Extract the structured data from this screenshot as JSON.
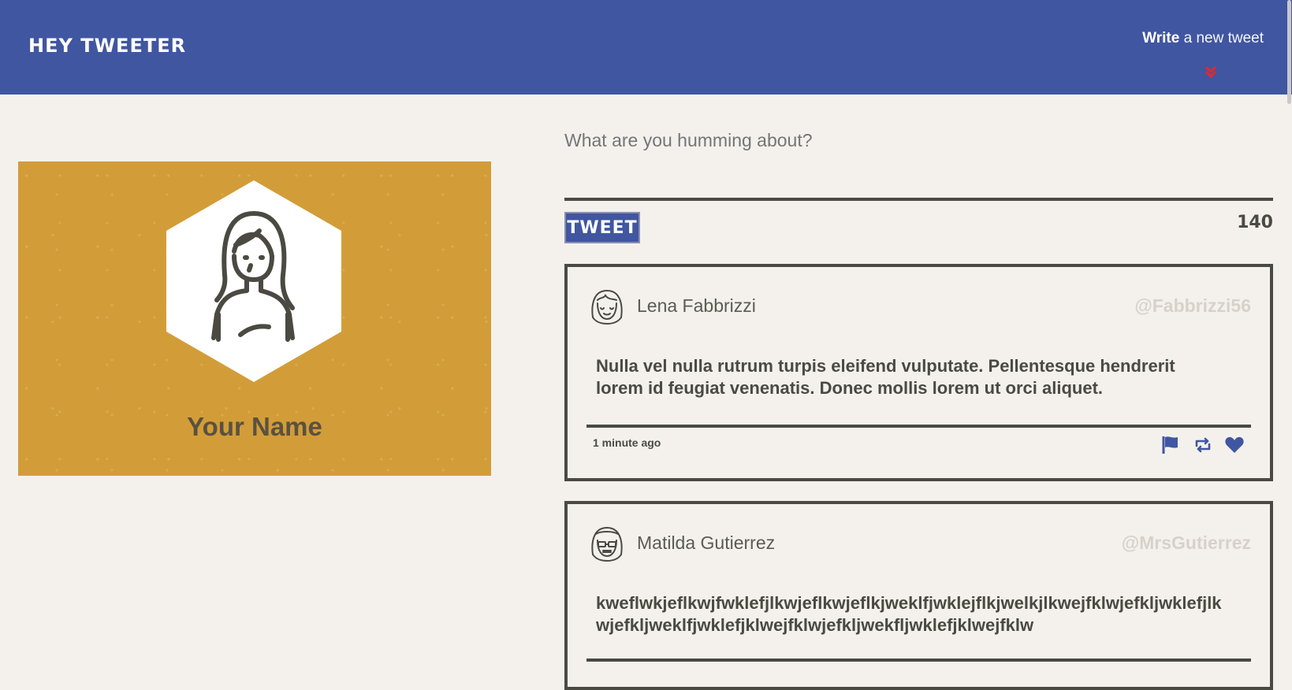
{
  "header": {
    "logo": "Hey Tweeter",
    "write_strong": "Write",
    "write_rest": " a new tweet",
    "chevron_icon": "double-chevron-down-icon",
    "accent": "#e02a2a",
    "bg": "#4056a1"
  },
  "profile": {
    "name": "Your Name",
    "avatar_icon": "woman-avatar-icon",
    "bg": "#d29d38"
  },
  "compose": {
    "placeholder": "What are you humming about?",
    "button_label": "Tweet",
    "counter": "140"
  },
  "tweets": [
    {
      "author": "Lena Fabbrizzi",
      "handle": "@Fabbrizzi56",
      "text": "Nulla vel nulla rutrum turpis eleifend vulputate. Pellentesque hendrerit lorem id feugiat venenatis. Donec mollis lorem ut orci aliquet.",
      "time": "1 minute ago",
      "avatar_icon": "smiling-girl-avatar-icon"
    },
    {
      "author": "Matilda Gutierrez",
      "handle": "@MrsGutierrez",
      "text": "kweflwkjeflkwjfwklefjlkwjeflkwjeflkjweklfjwklejflkjwelkjlkwejfklwjefkljwklefjlkwjefkljweklfjwklefjklwejfklwjefkljwekfljwklefjklwejfklw",
      "avatar_icon": "sunglasses-avatar-icon"
    }
  ],
  "actions": [
    "flag-icon",
    "retweet-icon",
    "heart-icon"
  ]
}
